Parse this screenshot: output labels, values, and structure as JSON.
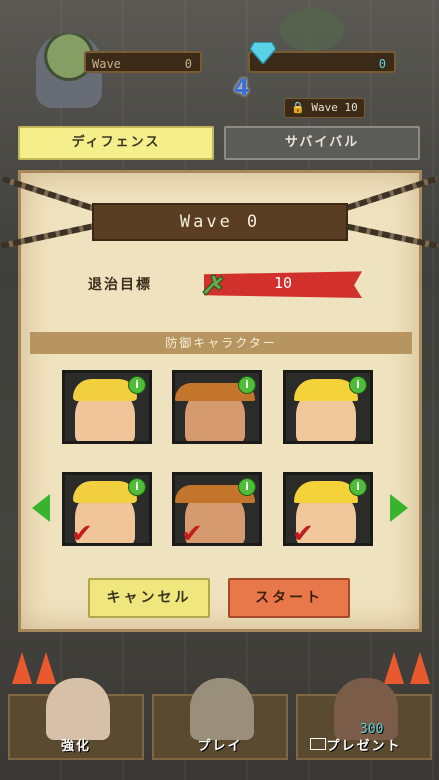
{
  "hud": {
    "wave_label": "Wave",
    "wave_value": "0",
    "gems_value": "0",
    "level_badge": "4",
    "locked_wave": "Wave 10"
  },
  "tabs": {
    "defense": "ディフェンス",
    "survival": "サバイバル"
  },
  "panel": {
    "wave_label": "Wave",
    "wave_value": "0",
    "target_label": "退治目標",
    "target_value": "10",
    "section_title": "防御キャラクター"
  },
  "characters_top": [
    {
      "name": "blond-hero",
      "info": "i"
    },
    {
      "name": "cowboy",
      "info": "i"
    },
    {
      "name": "cap-guy",
      "info": "i"
    }
  ],
  "characters_bottom": [
    {
      "name": "blond-hero",
      "info": "i",
      "check": "✔"
    },
    {
      "name": "cowboy",
      "info": "i",
      "check": "✔"
    },
    {
      "name": "cap-guy",
      "info": "i",
      "check": "✔"
    }
  ],
  "buttons": {
    "cancel": "キャンセル",
    "start": "スタート"
  },
  "nav": {
    "upgrade": "強化",
    "play": "プレイ",
    "gift": "プレゼント",
    "gift_count": "300"
  },
  "colors": {
    "accent_yellow": "#f4ef8a",
    "start_orange": "#e8784a",
    "info_green": "#4fbd3a",
    "target_red": "#d1302c"
  }
}
